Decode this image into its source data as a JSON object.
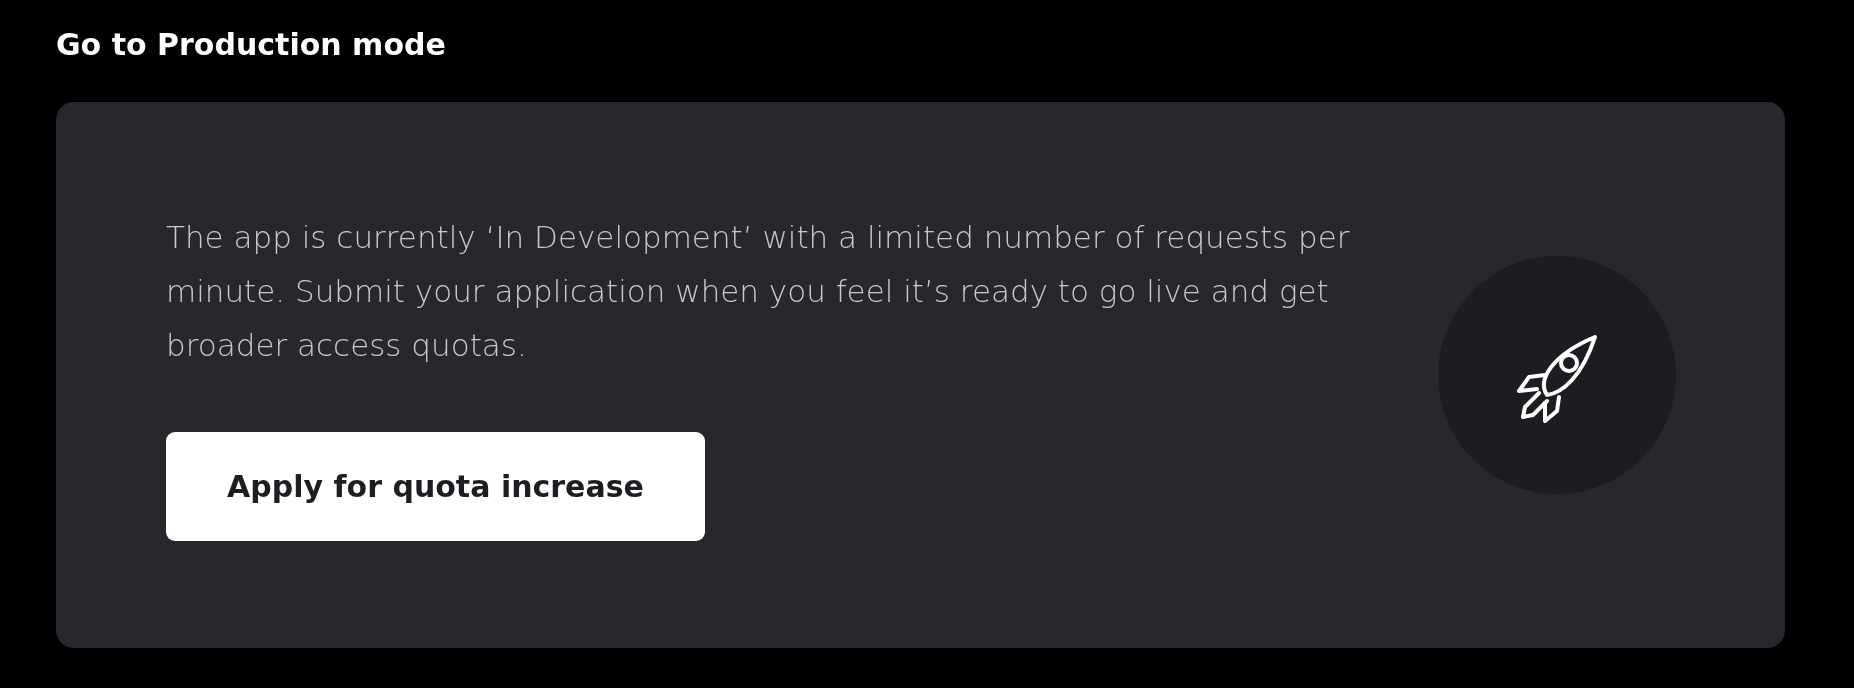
{
  "heading": "Go to Production mode",
  "card": {
    "description": "The app is currently ‘In Development’ with a limited number of requests per minute. Submit your application when you feel it’s ready to go live and get broader access quotas.",
    "button": "Apply for quota increase"
  }
}
